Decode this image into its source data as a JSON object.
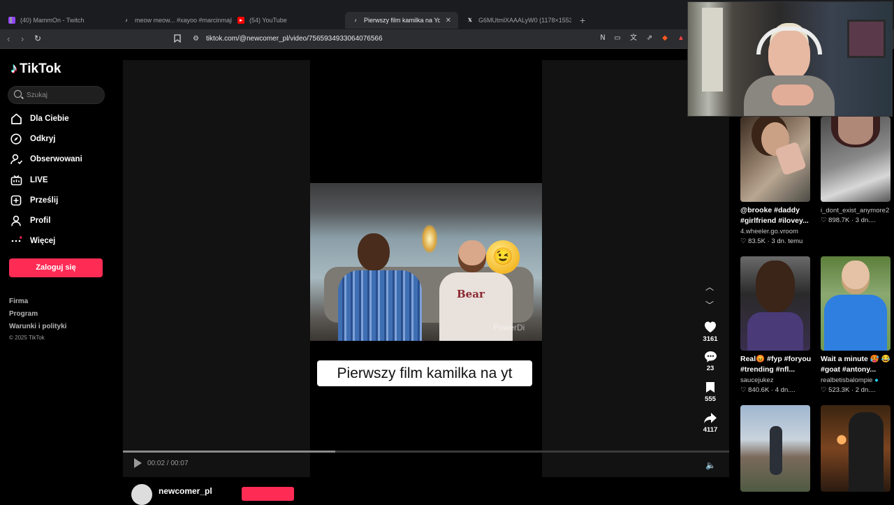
{
  "browser": {
    "tabs": [
      {
        "label": "(40) MammOn - Twitch",
        "icon": "twitch-icon",
        "color": "#9146ff"
      },
      {
        "label": "meow meow... #xayoo #marcinmajk...",
        "icon": "tiktok-icon",
        "color": "#000000"
      },
      {
        "label": "(54) YouTube",
        "icon": "youtube-icon",
        "color": "#ff0000"
      },
      {
        "label": "Pierwszy film kamilka na YouTub...",
        "icon": "tiktok-icon",
        "color": "#000000"
      },
      {
        "label": "G6MUtmlXAAALyW0 (1178×1553)",
        "icon": "x-icon",
        "color": "#000000"
      }
    ],
    "new_tab": "+",
    "url": "tiktok.com/@newcomer_pl/video/7565934933064076566"
  },
  "sidebar": {
    "logo": "TikTok",
    "search_placeholder": "Szukaj",
    "nav": [
      {
        "label": "Dla Ciebie",
        "icon": "home-icon"
      },
      {
        "label": "Odkryj",
        "icon": "compass-icon"
      },
      {
        "label": "Obserwowani",
        "icon": "following-icon"
      },
      {
        "label": "LIVE",
        "icon": "live-icon"
      },
      {
        "label": "Prześlij",
        "icon": "upload-icon"
      },
      {
        "label": "Profil",
        "icon": "profile-icon"
      },
      {
        "label": "Więcej",
        "icon": "more-icon"
      }
    ],
    "login_button": "Zaloguj się",
    "footer": [
      "Firma",
      "Program",
      "Warunki i polityki"
    ],
    "copyright": "© 2025 TikTok"
  },
  "player": {
    "caption": "Pierwszy film kamilka na yt",
    "watermark": "PowerDi",
    "time": "00:02 / 00:07",
    "progress": 0.35,
    "likes": "3161",
    "comments": "23",
    "saves": "555",
    "shares": "4117",
    "creator": "newcomer_pl"
  },
  "recommendations": [
    {
      "title": "@brooke #daddy #girlfriend #ilovey...",
      "author": "4.wheeler.go.vroom",
      "likes": "83.5K",
      "age": "3 dn. temu"
    },
    {
      "title": "",
      "author": "i_dont_exist_anymore2",
      "likes": "898.7K",
      "age": "3 dn...."
    },
    {
      "title": "Real😡 #fyp #foryou #trending #nfl...",
      "author": "saucejukez",
      "likes": "840.6K",
      "age": "4 dn...."
    },
    {
      "title": "Wait a minute 🥵 😂 #goat #antony...",
      "author": "realbetisbalompie",
      "likes": "523.3K",
      "age": "2 dn...."
    }
  ],
  "colors": {
    "accent": "#fe2c55",
    "background": "#000000",
    "player_bg": "#121212"
  }
}
